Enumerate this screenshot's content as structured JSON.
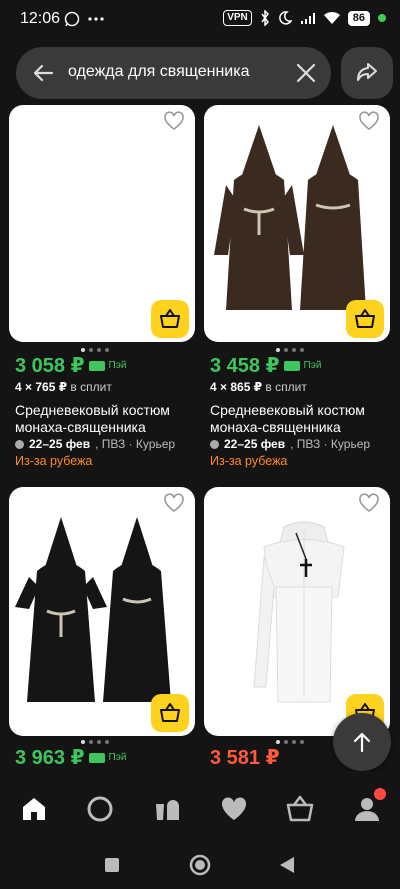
{
  "status": {
    "time": "12:06",
    "vpn": "VPN",
    "battery": "86"
  },
  "search": {
    "query": "одежда для священника"
  },
  "products": [
    {
      "price": "3 058 ₽",
      "pay": "Пэй",
      "split_count": "4 × 765 ₽",
      "split_label": "в сплит",
      "title": "Средневековый костюм монаха-священника",
      "delivery_date": "22–25 фев",
      "delivery_rest": ", ПВЗ · Курьер",
      "badge": "Из-за рубежа"
    },
    {
      "price": "3 458 ₽",
      "pay": "Пэй",
      "split_count": "4 × 865 ₽",
      "split_label": "в сплит",
      "title": "Средневековый костюм монаха-священника",
      "delivery_date": "22–25 фев",
      "delivery_rest": ", ПВЗ · Курьер",
      "badge": "Из-за рубежа"
    },
    {
      "price": "3 963 ₽",
      "pay": "Пэй"
    },
    {
      "price": "3 581 ₽"
    }
  ],
  "nav": {
    "items": [
      "home-icon",
      "alice-icon",
      "catalog-icon",
      "favorites-icon",
      "cart-icon",
      "profile-icon"
    ]
  },
  "colors": {
    "price_green": "#3fc55e",
    "price_red": "#ff5a3c",
    "accent_yellow": "#ffd21e",
    "abroad_orange": "#ff8a1e"
  }
}
